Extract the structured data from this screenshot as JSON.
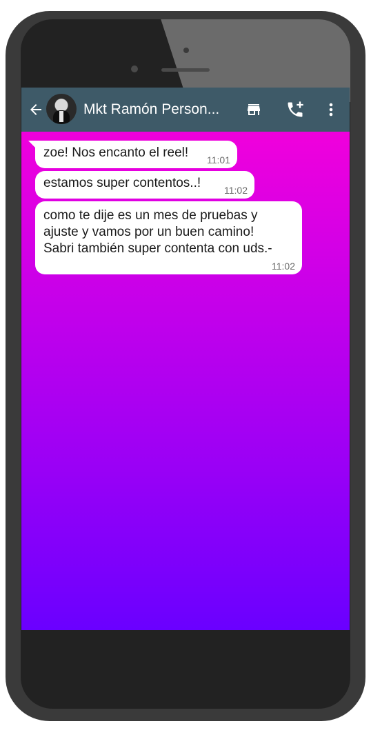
{
  "colors": {
    "app_bar": "#3e5a68",
    "bubble": "#ffffff",
    "screen_gradient_top": "#fb00d8",
    "screen_gradient_bottom": "#6a00ff",
    "phone_body": "#3a3a3a"
  },
  "header": {
    "back_icon": "arrow-left-icon",
    "avatar": "contact-photo",
    "contact_name": "Mkt Ramón Person...",
    "store_icon": "storefront-icon",
    "call_icon": "add-call-icon",
    "menu_icon": "more-vert-icon"
  },
  "messages": [
    {
      "text": "zoe! Nos encanto el reel!",
      "time": "11:01"
    },
    {
      "text": "estamos super contentos..!",
      "time": "11:02"
    },
    {
      "text": "como te dije es un mes de pruebas y\najuste y vamos por un buen camino!\nSabri también super contenta con uds.-",
      "time": "11:02"
    }
  ]
}
